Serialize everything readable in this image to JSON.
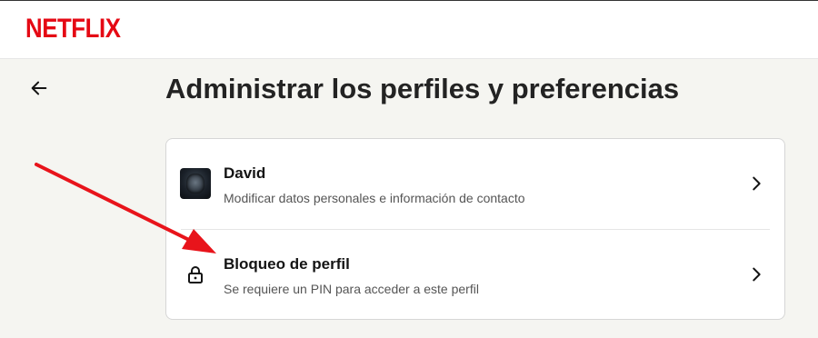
{
  "brand": {
    "logo_text": "NETFLIX",
    "color": "#e50914"
  },
  "header": {
    "back_icon": "arrow-left-icon"
  },
  "page": {
    "title": "Administrar los perfiles y preferencias"
  },
  "settings": {
    "items": [
      {
        "title": "David",
        "subtitle": "Modificar datos personales e información de contacto",
        "icon": "profile-avatar"
      },
      {
        "title": "Bloqueo de perfil",
        "subtitle": "Se requiere un PIN para acceder a este perfil",
        "icon": "lock-icon"
      }
    ]
  },
  "annotation": {
    "icon": "red-arrow",
    "color": "#e8141b"
  }
}
